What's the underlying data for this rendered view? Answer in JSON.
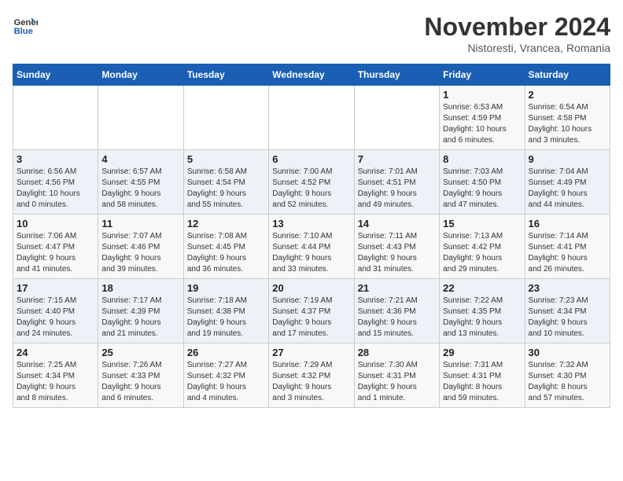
{
  "header": {
    "logo_line1": "General",
    "logo_line2": "Blue",
    "month": "November 2024",
    "location": "Nistoresti, Vrancea, Romania"
  },
  "days_of_week": [
    "Sunday",
    "Monday",
    "Tuesday",
    "Wednesday",
    "Thursday",
    "Friday",
    "Saturday"
  ],
  "weeks": [
    [
      {
        "day": "",
        "info": ""
      },
      {
        "day": "",
        "info": ""
      },
      {
        "day": "",
        "info": ""
      },
      {
        "day": "",
        "info": ""
      },
      {
        "day": "",
        "info": ""
      },
      {
        "day": "1",
        "info": "Sunrise: 6:53 AM\nSunset: 4:59 PM\nDaylight: 10 hours\nand 6 minutes."
      },
      {
        "day": "2",
        "info": "Sunrise: 6:54 AM\nSunset: 4:58 PM\nDaylight: 10 hours\nand 3 minutes."
      }
    ],
    [
      {
        "day": "3",
        "info": "Sunrise: 6:56 AM\nSunset: 4:56 PM\nDaylight: 10 hours\nand 0 minutes."
      },
      {
        "day": "4",
        "info": "Sunrise: 6:57 AM\nSunset: 4:55 PM\nDaylight: 9 hours\nand 58 minutes."
      },
      {
        "day": "5",
        "info": "Sunrise: 6:58 AM\nSunset: 4:54 PM\nDaylight: 9 hours\nand 55 minutes."
      },
      {
        "day": "6",
        "info": "Sunrise: 7:00 AM\nSunset: 4:52 PM\nDaylight: 9 hours\nand 52 minutes."
      },
      {
        "day": "7",
        "info": "Sunrise: 7:01 AM\nSunset: 4:51 PM\nDaylight: 9 hours\nand 49 minutes."
      },
      {
        "day": "8",
        "info": "Sunrise: 7:03 AM\nSunset: 4:50 PM\nDaylight: 9 hours\nand 47 minutes."
      },
      {
        "day": "9",
        "info": "Sunrise: 7:04 AM\nSunset: 4:49 PM\nDaylight: 9 hours\nand 44 minutes."
      }
    ],
    [
      {
        "day": "10",
        "info": "Sunrise: 7:06 AM\nSunset: 4:47 PM\nDaylight: 9 hours\nand 41 minutes."
      },
      {
        "day": "11",
        "info": "Sunrise: 7:07 AM\nSunset: 4:46 PM\nDaylight: 9 hours\nand 39 minutes."
      },
      {
        "day": "12",
        "info": "Sunrise: 7:08 AM\nSunset: 4:45 PM\nDaylight: 9 hours\nand 36 minutes."
      },
      {
        "day": "13",
        "info": "Sunrise: 7:10 AM\nSunset: 4:44 PM\nDaylight: 9 hours\nand 33 minutes."
      },
      {
        "day": "14",
        "info": "Sunrise: 7:11 AM\nSunset: 4:43 PM\nDaylight: 9 hours\nand 31 minutes."
      },
      {
        "day": "15",
        "info": "Sunrise: 7:13 AM\nSunset: 4:42 PM\nDaylight: 9 hours\nand 29 minutes."
      },
      {
        "day": "16",
        "info": "Sunrise: 7:14 AM\nSunset: 4:41 PM\nDaylight: 9 hours\nand 26 minutes."
      }
    ],
    [
      {
        "day": "17",
        "info": "Sunrise: 7:15 AM\nSunset: 4:40 PM\nDaylight: 9 hours\nand 24 minutes."
      },
      {
        "day": "18",
        "info": "Sunrise: 7:17 AM\nSunset: 4:39 PM\nDaylight: 9 hours\nand 21 minutes."
      },
      {
        "day": "19",
        "info": "Sunrise: 7:18 AM\nSunset: 4:38 PM\nDaylight: 9 hours\nand 19 minutes."
      },
      {
        "day": "20",
        "info": "Sunrise: 7:19 AM\nSunset: 4:37 PM\nDaylight: 9 hours\nand 17 minutes."
      },
      {
        "day": "21",
        "info": "Sunrise: 7:21 AM\nSunset: 4:36 PM\nDaylight: 9 hours\nand 15 minutes."
      },
      {
        "day": "22",
        "info": "Sunrise: 7:22 AM\nSunset: 4:35 PM\nDaylight: 9 hours\nand 13 minutes."
      },
      {
        "day": "23",
        "info": "Sunrise: 7:23 AM\nSunset: 4:34 PM\nDaylight: 9 hours\nand 10 minutes."
      }
    ],
    [
      {
        "day": "24",
        "info": "Sunrise: 7:25 AM\nSunset: 4:34 PM\nDaylight: 9 hours\nand 8 minutes."
      },
      {
        "day": "25",
        "info": "Sunrise: 7:26 AM\nSunset: 4:33 PM\nDaylight: 9 hours\nand 6 minutes."
      },
      {
        "day": "26",
        "info": "Sunrise: 7:27 AM\nSunset: 4:32 PM\nDaylight: 9 hours\nand 4 minutes."
      },
      {
        "day": "27",
        "info": "Sunrise: 7:29 AM\nSunset: 4:32 PM\nDaylight: 9 hours\nand 3 minutes."
      },
      {
        "day": "28",
        "info": "Sunrise: 7:30 AM\nSunset: 4:31 PM\nDaylight: 9 hours\nand 1 minute."
      },
      {
        "day": "29",
        "info": "Sunrise: 7:31 AM\nSunset: 4:31 PM\nDaylight: 8 hours\nand 59 minutes."
      },
      {
        "day": "30",
        "info": "Sunrise: 7:32 AM\nSunset: 4:30 PM\nDaylight: 8 hours\nand 57 minutes."
      }
    ]
  ]
}
